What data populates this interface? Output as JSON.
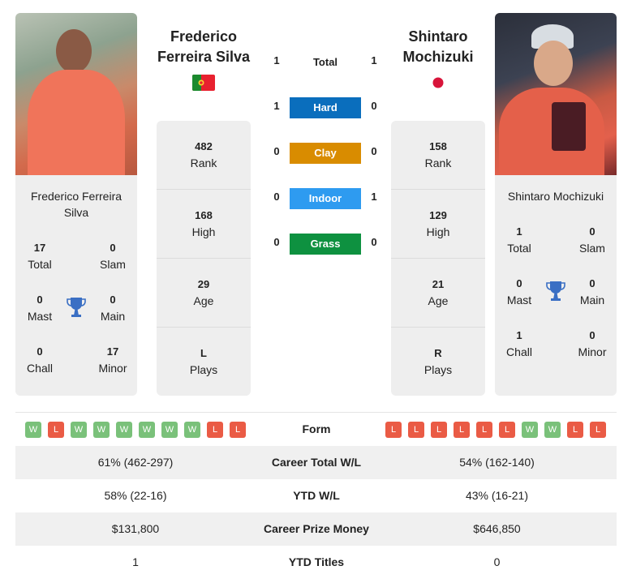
{
  "players": {
    "left": {
      "name": "Frederico Ferreira Silva",
      "name_line1": "Frederico",
      "name_line2": "Ferreira Silva",
      "card_name": "Frederico Ferreira Silva",
      "country": "Portugal",
      "flag_icon": "portugal-flag-icon",
      "titles": {
        "total": {
          "value": "17",
          "label": "Total"
        },
        "slam": {
          "value": "0",
          "label": "Slam"
        },
        "mast": {
          "value": "0",
          "label": "Mast"
        },
        "main": {
          "value": "0",
          "label": "Main"
        },
        "chall": {
          "value": "0",
          "label": "Chall"
        },
        "minor": {
          "value": "17",
          "label": "Minor"
        }
      },
      "rank": {
        "value": "482",
        "label": "Rank"
      },
      "high": {
        "value": "168",
        "label": "High"
      },
      "age": {
        "value": "29",
        "label": "Age"
      },
      "plays": {
        "value": "L",
        "label": "Plays"
      }
    },
    "right": {
      "name": "Shintaro Mochizuki",
      "name_line1": "Shintaro",
      "name_line2": "Mochizuki",
      "card_name": "Shintaro Mochizuki",
      "country": "Japan",
      "flag_icon": "japan-flag-icon",
      "titles": {
        "total": {
          "value": "1",
          "label": "Total"
        },
        "slam": {
          "value": "0",
          "label": "Slam"
        },
        "mast": {
          "value": "0",
          "label": "Mast"
        },
        "main": {
          "value": "0",
          "label": "Main"
        },
        "chall": {
          "value": "1",
          "label": "Chall"
        },
        "minor": {
          "value": "0",
          "label": "Minor"
        }
      },
      "rank": {
        "value": "158",
        "label": "Rank"
      },
      "high": {
        "value": "129",
        "label": "High"
      },
      "age": {
        "value": "21",
        "label": "Age"
      },
      "plays": {
        "value": "R",
        "label": "Plays"
      }
    }
  },
  "h2h": {
    "total": {
      "label": "Total",
      "left": "1",
      "right": "1"
    },
    "surfaces": [
      {
        "label": "Hard",
        "left": "1",
        "right": "0",
        "color": "#0a6ebd"
      },
      {
        "label": "Clay",
        "left": "0",
        "right": "0",
        "color": "#d98c00"
      },
      {
        "label": "Indoor",
        "left": "0",
        "right": "1",
        "color": "#2e9bf0"
      },
      {
        "label": "Grass",
        "left": "0",
        "right": "0",
        "color": "#0e9140"
      }
    ]
  },
  "comparison": {
    "form": {
      "label": "Form",
      "left": [
        "W",
        "L",
        "W",
        "W",
        "W",
        "W",
        "W",
        "W",
        "L",
        "L"
      ],
      "right": [
        "L",
        "L",
        "L",
        "L",
        "L",
        "L",
        "W",
        "W",
        "L",
        "L"
      ]
    },
    "rows": [
      {
        "label": "Career Total W/L",
        "left": "61% (462-297)",
        "right": "54% (162-140)"
      },
      {
        "label": "YTD W/L",
        "left": "58% (22-16)",
        "right": "43% (16-21)"
      },
      {
        "label": "Career Prize Money",
        "left": "$131,800",
        "right": "$646,850"
      },
      {
        "label": "YTD Titles",
        "left": "1",
        "right": "0"
      }
    ]
  },
  "colors": {
    "win": "#7ac17a",
    "loss": "#ea5b45",
    "trophy": "#3a6fc4"
  }
}
